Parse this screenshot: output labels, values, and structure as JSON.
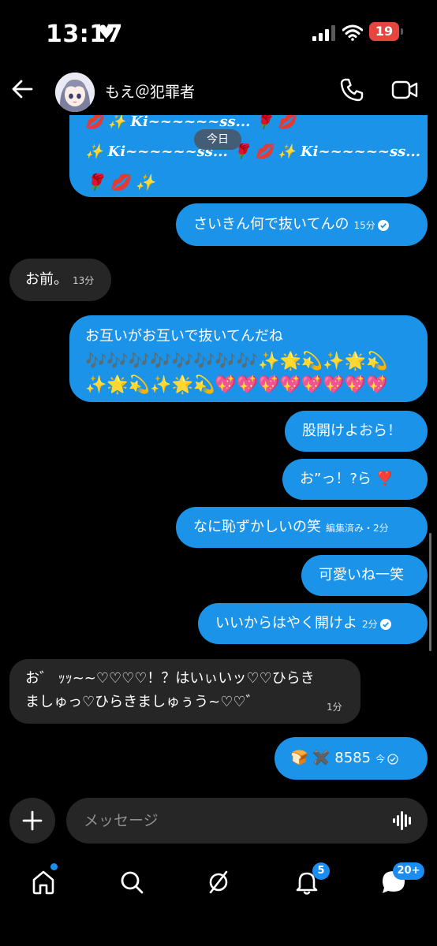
{
  "status_bar": {
    "time": "13:17",
    "battery": "19"
  },
  "header": {
    "contact_name": "もえ＠犯罪者"
  },
  "date_divider": "今日",
  "messages": [
    {
      "side": "sent",
      "lines": [
        "💋 ✨ Ki~~~~~~ss... 🌹 💋",
        "✨ Ki~~~~~~ss... 🌹 💋 ✨ Ki~~~~~~ss...",
        "🌹 💋 ✨"
      ]
    },
    {
      "side": "sent",
      "text": "さいきん何で抜いてんの",
      "time": "15分"
    },
    {
      "side": "received",
      "text": "お前。",
      "time": "13分"
    },
    {
      "side": "sent",
      "text": "お互いがお互いで抜いてんだね",
      "emoji_rows": [
        "🎶🎶🎶🎶🎶🎶🎶🎶✨🌟💫✨🌟💫",
        "✨🌟💫✨🌟💫💖💖💖💖💖💖💖💖"
      ]
    },
    {
      "side": "sent",
      "text": "股開けよおら！"
    },
    {
      "side": "sent",
      "text": "お”っ！?ら ❣️"
    },
    {
      "side": "sent",
      "text": "なに恥ずかしいの笑",
      "time": "編集済み・2分"
    },
    {
      "side": "sent",
      "text": "可愛いね一笑"
    },
    {
      "side": "sent",
      "text": "いいからはやく開けよ",
      "time": "2分"
    },
    {
      "side": "received",
      "lines": [
        "お゛ ｯｯ~~♡♡♡♡！？はいぃいッ♡♡ひらき",
        "ましゅっ♡ひらきましゅぅう~♡♡゛"
      ],
      "time": "1分"
    },
    {
      "side": "sent",
      "text": "🍞 ✖️ 8585",
      "time": "今"
    }
  ],
  "composer": {
    "placeholder": "メッセージ"
  },
  "bottom_nav": {
    "notifications_badge": "5",
    "messages_badge": "20+"
  },
  "colors": {
    "sent_bubble": "#1b93e9",
    "received_bubble": "#262626",
    "badge": "#1b8cf0",
    "battery": "#e5453e"
  }
}
